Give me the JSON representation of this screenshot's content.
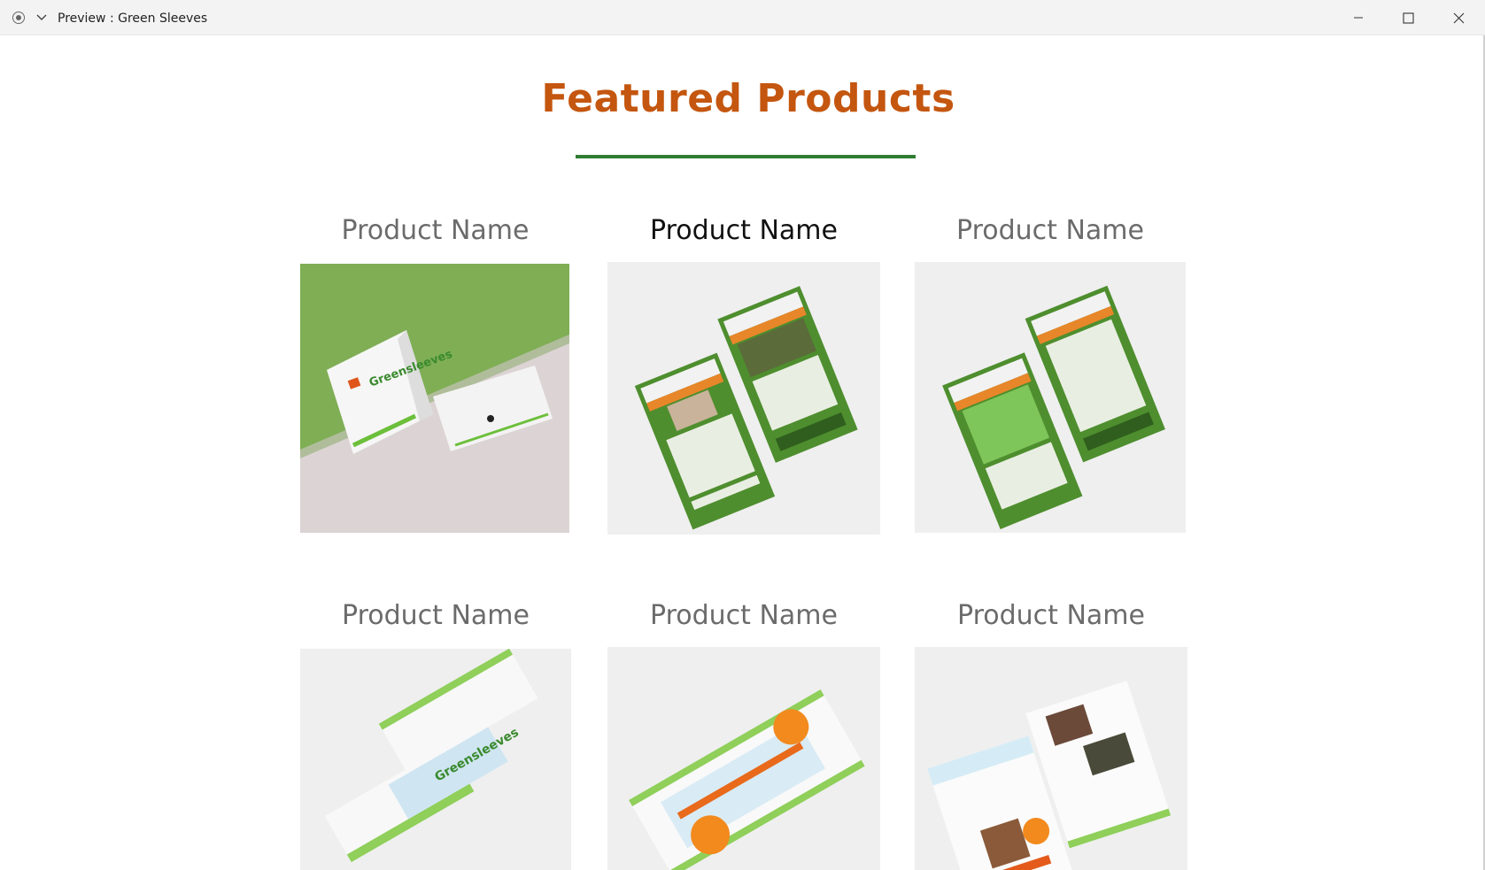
{
  "window": {
    "title": "Preview : Green Sleeves"
  },
  "page": {
    "heading": "Featured Products",
    "accent_color": "#c4560f",
    "rule_color": "#2e7d32"
  },
  "products": [
    {
      "name": "Product Name",
      "image": "business-card-mockup"
    },
    {
      "name": "Product Name",
      "image": "flyer-pair-mockup"
    },
    {
      "name": "Product Name",
      "image": "flyer-pair-mockup"
    },
    {
      "name": "Product Name",
      "image": "compliment-slip-mockup"
    },
    {
      "name": "Product Name",
      "image": "offer-flyer-mockup"
    },
    {
      "name": "Product Name",
      "image": "leaflet-mockup"
    }
  ]
}
